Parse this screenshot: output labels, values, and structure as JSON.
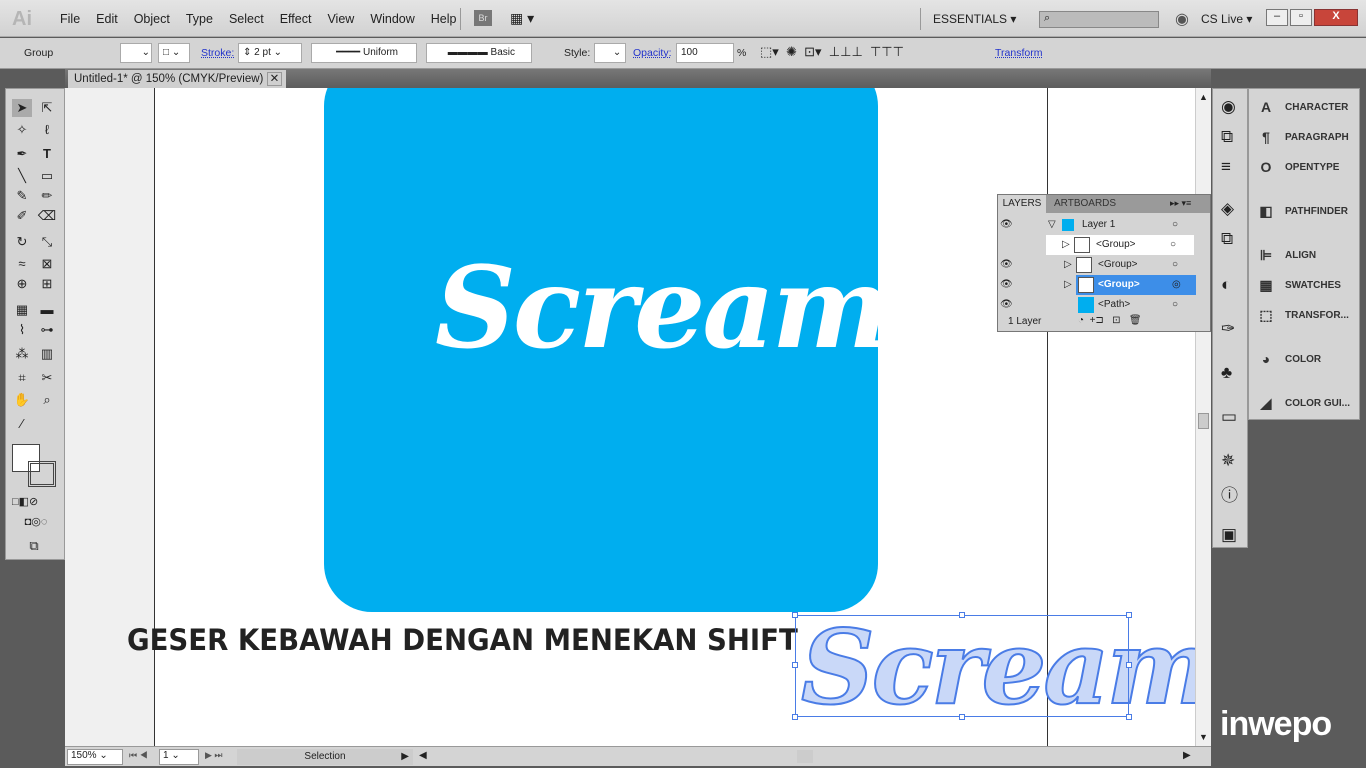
{
  "app": {
    "logo": "Ai",
    "menus": [
      "File",
      "Edit",
      "Object",
      "Type",
      "Select",
      "Effect",
      "View",
      "Window",
      "Help"
    ],
    "bridge": "Br",
    "workspace": "ESSENTIALS",
    "cs_live": "CS Live"
  },
  "control": {
    "selection": "Group",
    "stroke_label": "Stroke:",
    "stroke_value": "2 pt",
    "profile": "Uniform",
    "brush": "Basic",
    "style_label": "Style:",
    "opacity_label": "Opacity:",
    "opacity_value": "100",
    "percent": "%",
    "transform": "Transform"
  },
  "document": {
    "tab": "Untitled-1* @ 150% (CMYK/Preview)"
  },
  "artwork": {
    "title": "Scream",
    "caption": "GESER KEBAWAH DENGAN MENEKAN SHIFT",
    "outline": "Scream",
    "card_color": "#00aeef"
  },
  "status": {
    "zoom": "150%",
    "artboard": "1",
    "tool": "Selection"
  },
  "layers": {
    "tabs": [
      "LAYERS",
      "ARTBOARDS"
    ],
    "rows": [
      "Layer 1",
      "<Group>",
      "<Group>",
      "<Group>",
      "<Path>"
    ],
    "count": "1 Layer"
  },
  "panels": [
    "CHARACTER",
    "PARAGRAPH",
    "OPENTYPE",
    "PATHFINDER",
    "ALIGN",
    "SWATCHES",
    "TRANSFOR...",
    "COLOR",
    "COLOR GUI..."
  ],
  "watermark": "inwepo"
}
